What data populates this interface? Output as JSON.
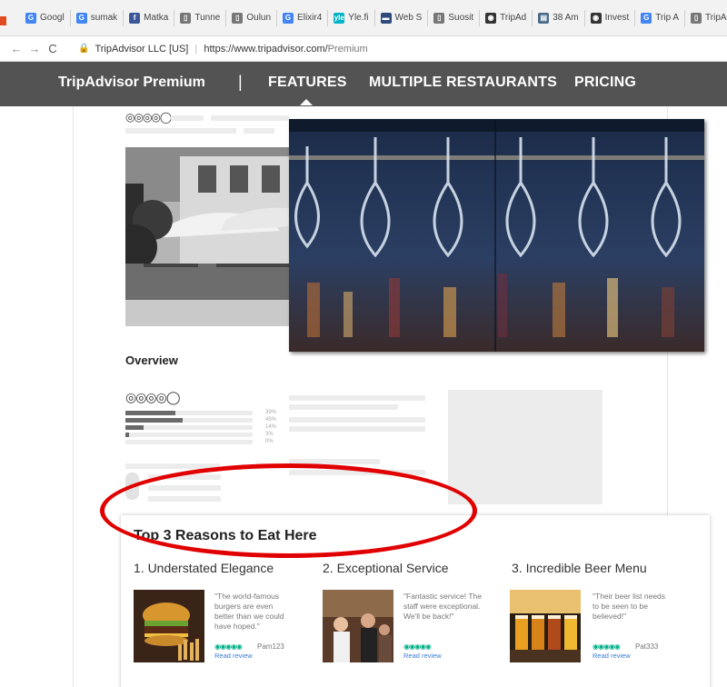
{
  "bookmarks": [
    {
      "icon": "google-icon",
      "label": "Googl",
      "color": "#4285f4",
      "glyph": "G"
    },
    {
      "icon": "google-icon",
      "label": "sumak",
      "color": "#4285f4",
      "glyph": "G"
    },
    {
      "icon": "facebook-icon",
      "label": "Matka",
      "color": "#3b5998",
      "glyph": "f"
    },
    {
      "icon": "page-icon",
      "label": "Tunne",
      "color": "#777777",
      "glyph": "▯"
    },
    {
      "icon": "page-icon",
      "label": "Oulun",
      "color": "#777777",
      "glyph": "▯"
    },
    {
      "icon": "google-icon",
      "label": "Elixir4",
      "color": "#4285f4",
      "glyph": "G"
    },
    {
      "icon": "yle-icon",
      "label": "Yle.fi",
      "color": "#00b4c8",
      "glyph": "yle"
    },
    {
      "icon": "web-icon",
      "label": "Web S",
      "color": "#2d4a7a",
      "glyph": "▬"
    },
    {
      "icon": "page-icon",
      "label": "Suosit",
      "color": "#777777",
      "glyph": "▯"
    },
    {
      "icon": "tripadvisor-icon",
      "label": "TripAd",
      "color": "#333333",
      "glyph": "◉"
    },
    {
      "icon": "calendar-icon",
      "label": "38 Am",
      "color": "#4a6a8a",
      "glyph": "▤"
    },
    {
      "icon": "tripadvisor-icon",
      "label": "Invest",
      "color": "#333333",
      "glyph": "◉"
    },
    {
      "icon": "google-icon",
      "label": "Trip A",
      "color": "#4285f4",
      "glyph": "G"
    },
    {
      "icon": "page-icon",
      "label": "TripAd",
      "color": "#777777",
      "glyph": "▯"
    }
  ],
  "address": {
    "site_name": "TripAdvisor LLC [US]",
    "url_host": "https://www.tripadvisor.com/",
    "url_path": "Premium"
  },
  "nav": {
    "brand": "TripAdvisor Premium",
    "separator": "|",
    "features": "FEATURES",
    "multiple": "MULTIPLE RESTAURANTS",
    "pricing": "PRICING"
  },
  "listing": {
    "rating_top": "◎◎◎◎◯",
    "overview_title": "Overview",
    "rating_overview": "◎◎◎◎◯",
    "breakdown": [
      {
        "pct": "39%",
        "fill": 0.39
      },
      {
        "pct": "45%",
        "fill": 0.45
      },
      {
        "pct": "14%",
        "fill": 0.14
      },
      {
        "pct": "3%",
        "fill": 0.03
      },
      {
        "pct": "0%",
        "fill": 0.0
      }
    ]
  },
  "reasons": {
    "title": "Top 3 Reasons to Eat Here",
    "items": [
      {
        "title": "1. Understated Elegance",
        "quote": "\"The world-famous burgers are even better than we could have hoped.\"",
        "rating": "◉◉◉◉◉",
        "author": "Pam123",
        "link": "Read review"
      },
      {
        "title": "2. Exceptional Service",
        "quote": "\"Fantastic service! The staff were exceptional. We'll be back!\"",
        "rating": "◉◉◉◉◉",
        "author": "",
        "link": "Read review"
      },
      {
        "title": "3. Incredible Beer Menu",
        "quote": "\"Their beer list needs to be seen to be believed!\"",
        "rating": "◉◉◉◉◉",
        "author": "Pat333",
        "link": "Read review"
      }
    ]
  }
}
